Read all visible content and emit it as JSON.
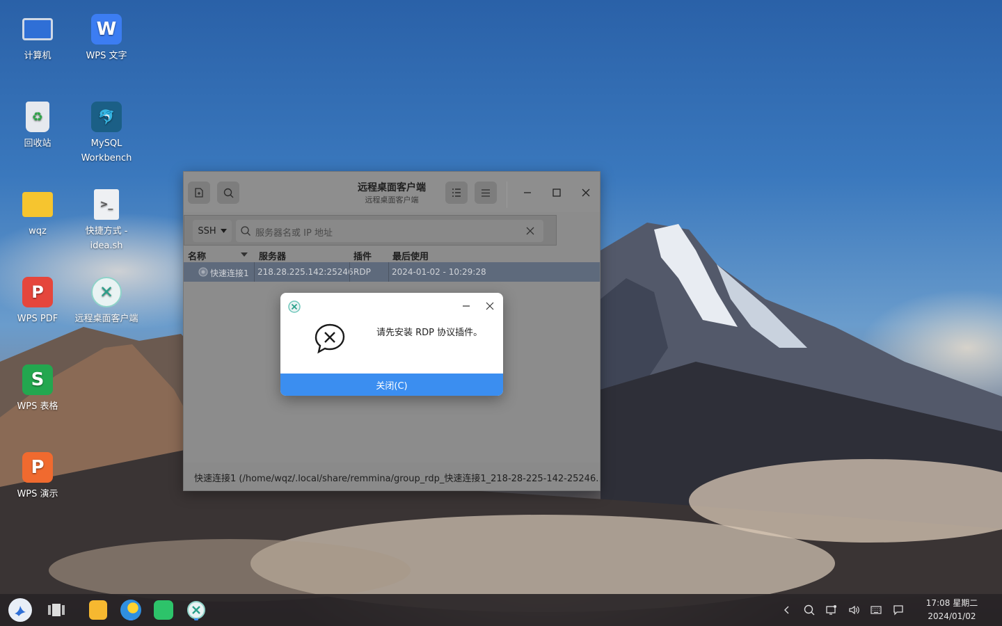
{
  "desktop": {
    "icons": [
      {
        "label": "计算机"
      },
      {
        "label": "WPS 文字"
      },
      {
        "label": "回收站"
      },
      {
        "label": "MySQL Workbench"
      },
      {
        "label": "wqz"
      },
      {
        "label": "快捷方式 - idea.sh"
      },
      {
        "label": "WPS PDF"
      },
      {
        "label": "远程桌面客户端"
      },
      {
        "label": "WPS 表格"
      },
      {
        "label": "WPS 演示"
      }
    ]
  },
  "window": {
    "title": "远程桌面客户端",
    "subtitle": "远程桌面客户端",
    "protocol": "SSH",
    "search_placeholder": "服务器名或 IP 地址",
    "columns": [
      "名称",
      "服务器",
      "插件",
      "最后使用"
    ],
    "rows": [
      {
        "name": "快速连接1",
        "server": "218.28.225.142:25246",
        "plugin": "RDP",
        "last_used": "2024-01-02 - 10:29:28"
      }
    ],
    "status": "快速连接1 (/home/wqz/.local/share/remmina/group_rdp_快速连接1_218-28-225-142-25246.…"
  },
  "dialog": {
    "message": "请先安装 RDP 协议插件。",
    "close_label": "关闭(C)"
  },
  "taskbar": {
    "time": "17:08 星期二",
    "date": "2024/01/02"
  },
  "colors": {
    "accent": "#3b8ef0",
    "selected_row": "#5e6a7c"
  }
}
